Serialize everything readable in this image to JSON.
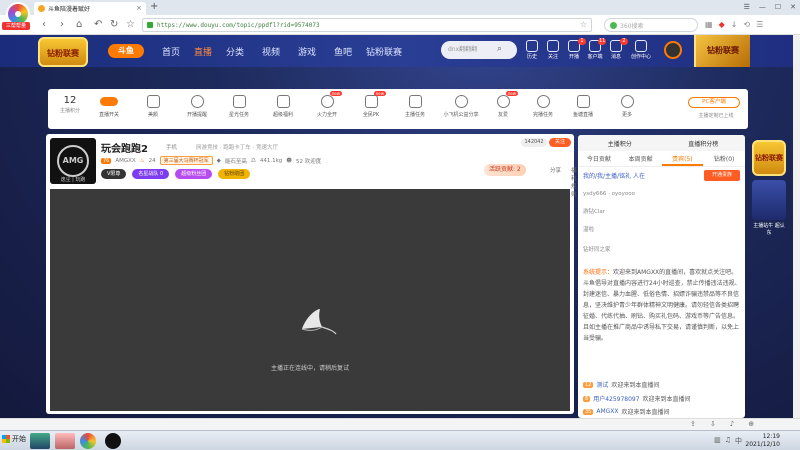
{
  "browser": {
    "brand": "三帮帮量",
    "tab_title": "斗鱼陪漫着赋好",
    "url": "https://www.douyu.com/topic/ppdfl?rid=9574073",
    "search_placeholder": "360搜索"
  },
  "site": {
    "logo_text": "钻粉联赛",
    "brand": "斗鱼",
    "nav": [
      "首页",
      "直播",
      "分类",
      "视频",
      "游戏",
      "鱼吧",
      "钻粉联赛"
    ],
    "search_placeholder": "dnx翻翻翻",
    "header_icons": [
      "历史",
      "关注",
      "开播",
      "客户端",
      "消息",
      "创作中心"
    ],
    "badges": {
      "kaibo": "1",
      "kehu": "11",
      "xiaoxi": "2"
    },
    "promo": "钻粉联赛"
  },
  "toolbar": {
    "level_number": "12",
    "level_label": "主播积分",
    "items": [
      "直播开关",
      "美颜",
      "开播提醒",
      "星光任务",
      "超级福利",
      "火力全开",
      "全民PK",
      "主播任务",
      "小飞机公益分享",
      "友爱",
      "完播任务",
      "鱼塘直播",
      "更多"
    ],
    "new_tag": "new",
    "pc_client": "PC客户端",
    "pc_sub": "主播定制已上线"
  },
  "room": {
    "avatar_text": "AMG",
    "avatar_caption": "逸尘 | 玩跑",
    "title": "玩会跑跑2",
    "tag": "手机",
    "categories": "网游竞技 · 跑跑卡丁车 · 竞速大厅",
    "anchor_level": "76",
    "anchor_name": "AMGXX",
    "anchor_rank": "24",
    "rank_badge": "第三届大马赛杯冠军",
    "gold": "能石至高",
    "hot": "441.1kg",
    "viewers": "52 欢迎度",
    "pills": [
      "V限尊",
      "名星战队 0",
      "超级粉丝团",
      "钻粉助团"
    ],
    "fans": "142042",
    "follow": "关注",
    "gift": "活跃贡献: 2",
    "share": "分享",
    "report": "福利规则",
    "video_status": "主播正在连线中，请稍后复试"
  },
  "chat": {
    "top_tabs": [
      "主播积分",
      "直播积分榜"
    ],
    "tabs": [
      "今日贡献",
      "本周贡献",
      "贵宾(5)",
      "钻粉(0)"
    ],
    "notice": "我的/我/主播/铭礼 人在",
    "open_btn": "开通贵族",
    "lines": [
      "ysdy666 · oyoyooo",
      "游钻Clar",
      "温啦",
      "钻好同之家"
    ],
    "sys_label": "系统提示：",
    "sys_text": "欢迎来到AMGXX的直播间，喜欢就点关注吧。斗鱼倡导对直播内容进行24小时巡查，禁止传播违法违规、封建迷信、暴力血腥、低俗色情、招嫖诈骗违禁品等不良信息，坚决维护青少年群体精神文明健康。请勿轻信各类招聘征婚、代练代抽、刷钻、购买礼包码、游戏币等广告信息。且如主播在推广商品中诱导私下交易，请谨慎判断，以免上当受骗。",
    "welcomes": [
      {
        "level": "12",
        "name": "测试",
        "text": "欢迎来到本直播间"
      },
      {
        "level": "8",
        "name": "用户425978097",
        "text": "欢迎来到本直播间"
      },
      {
        "level": "35",
        "name": "AMGXX",
        "text": "欢迎来到本直播间"
      }
    ]
  },
  "side": {
    "badge": "钻粉联赛",
    "caption": "主播站牛 超认东"
  },
  "taskbar": {
    "start": "开始",
    "time": "12:19",
    "date": "2021/12/10"
  }
}
